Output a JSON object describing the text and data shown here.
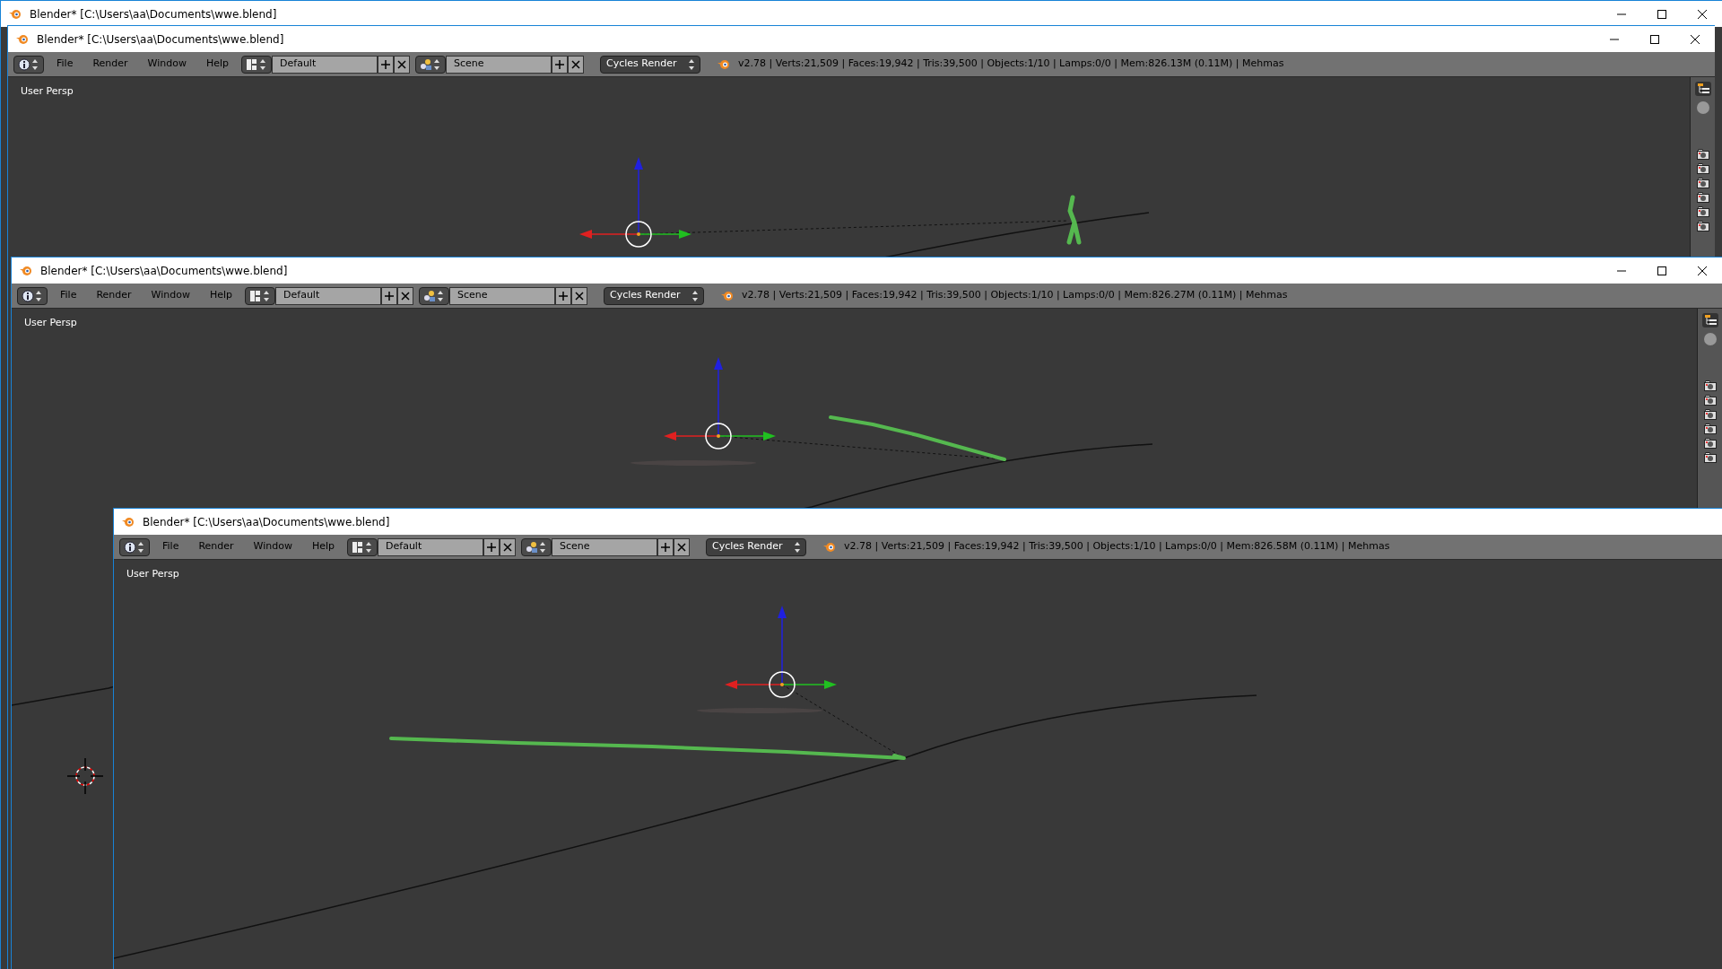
{
  "windows": [
    {
      "title": "Blender* [C:\\Users\\aa\\Documents\\wwe.blend]",
      "controls": true
    },
    {
      "title": "Blender* [C:\\Users\\aa\\Documents\\wwe.blend]",
      "controls": true,
      "header": {
        "menus": [
          "File",
          "Render",
          "Window",
          "Help"
        ],
        "layout": "Default",
        "scene": "Scene",
        "engine": "Cycles Render",
        "stats": "v2.78 | Verts:21,509 | Faces:19,942 | Tris:39,500 | Objects:1/10 | Lamps:0/0 | Mem:826.13M (0.11M) | Mehmas"
      },
      "viewport": {
        "label": "User Persp"
      }
    },
    {
      "title": "Blender* [C:\\Users\\aa\\Documents\\wwe.blend]",
      "controls": true,
      "header": {
        "menus": [
          "File",
          "Render",
          "Window",
          "Help"
        ],
        "layout": "Default",
        "scene": "Scene",
        "engine": "Cycles Render",
        "stats": "v2.78 | Verts:21,509 | Faces:19,942 | Tris:39,500 | Objects:1/10 | Lamps:0/0 | Mem:826.27M (0.11M) | Mehmas"
      },
      "viewport": {
        "label": "User Persp"
      }
    },
    {
      "title": "Blender* [C:\\Users\\aa\\Documents\\wwe.blend]",
      "controls": false,
      "header": {
        "menus": [
          "File",
          "Render",
          "Window",
          "Help"
        ],
        "layout": "Default",
        "scene": "Scene",
        "engine": "Cycles Render",
        "stats": "v2.78 | Verts:21,509 | Faces:19,942 | Tris:39,500 | Objects:1/10 | Lamps:0/0 | Mem:826.58M (0.11M) | Mehmas"
      },
      "viewport": {
        "label": "User Persp"
      }
    }
  ]
}
